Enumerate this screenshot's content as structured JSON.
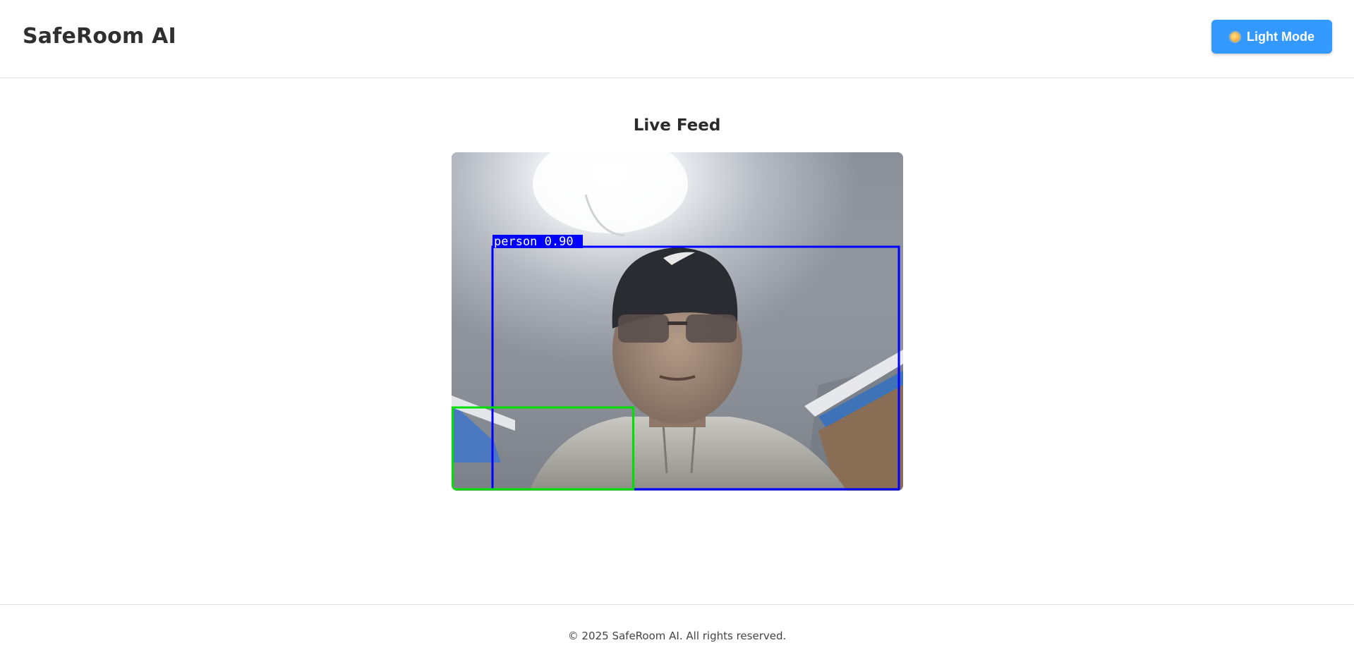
{
  "header": {
    "brand": "SafeRoom AI",
    "theme_button": {
      "icon": "sun-icon",
      "label": "Light Mode",
      "color": "#3399ff"
    }
  },
  "main": {
    "section_title": "Live Feed",
    "feed": {
      "detections": [
        {
          "label": "person 0.90",
          "color": "#0000ff"
        },
        {
          "label": "",
          "color": "#00e000"
        }
      ]
    }
  },
  "footer": {
    "copyright": "© 2025 SafeRoom AI. All rights reserved."
  }
}
